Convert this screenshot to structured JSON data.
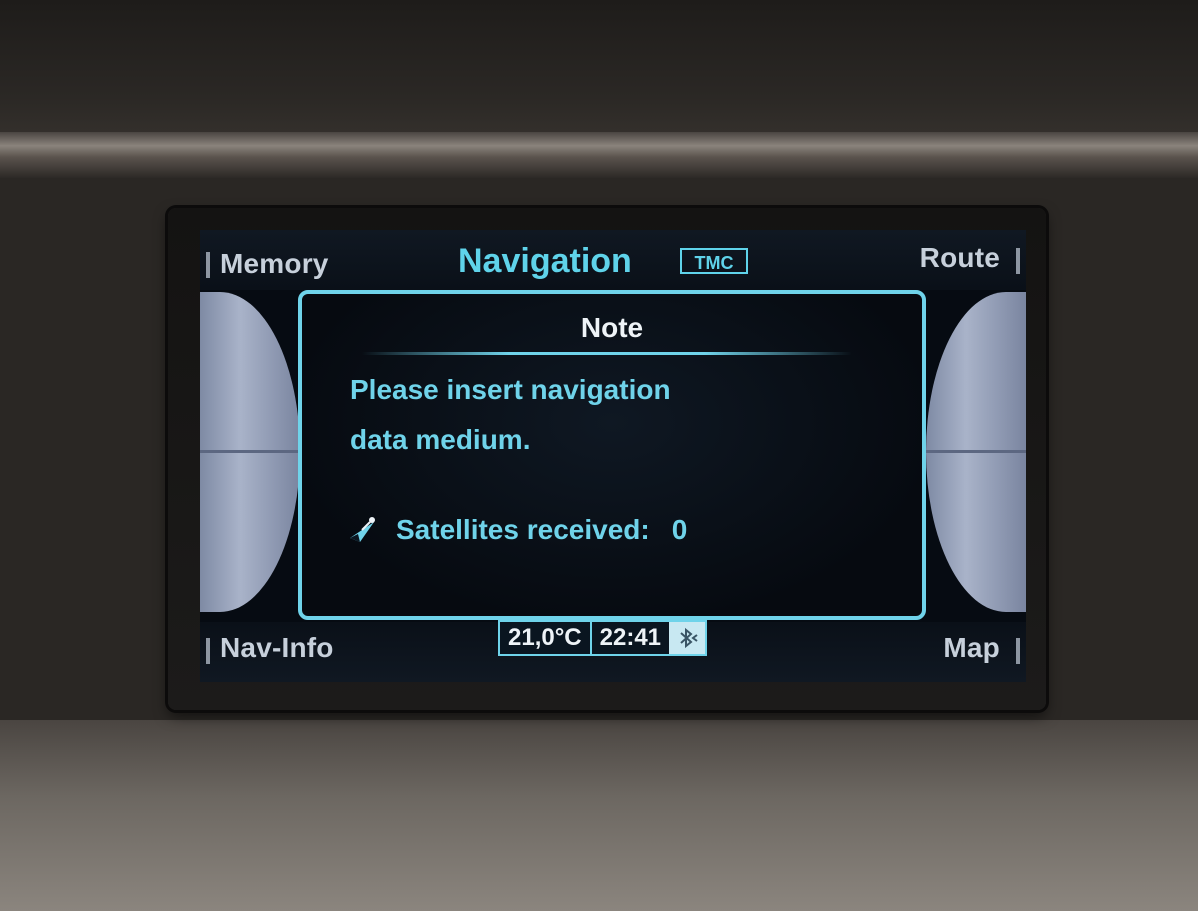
{
  "header": {
    "title": "Navigation",
    "tmc_badge": "TMC",
    "softkey_top_left": "Memory",
    "softkey_top_right": "Route"
  },
  "dialog": {
    "title": "Note",
    "message_line1": "Please insert navigation",
    "message_line2": "data medium.",
    "satellites_label": "Satellites received:",
    "satellites_value": "0",
    "satellite_icon": "satellite-icon"
  },
  "footer": {
    "softkey_bottom_left": "Nav-Info",
    "softkey_bottom_right": "Map",
    "temperature": "21,0°C",
    "time": "22:41",
    "bluetooth_icon": "bluetooth-icon"
  },
  "colors": {
    "accent": "#5fd3ea",
    "screen_background": "#060b12",
    "softkey_text": "#c7d0db",
    "dial": "#a9b3c9"
  }
}
